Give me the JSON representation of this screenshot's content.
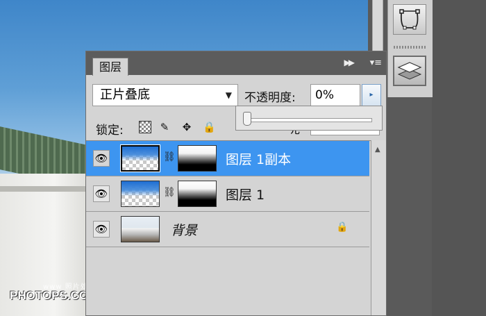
{
  "panel": {
    "tab_label": "图层",
    "collapse_glyph": "▶▶",
    "menu_glyph": "▾≡"
  },
  "blend_mode": {
    "value": "正片叠底",
    "arrow": "▼"
  },
  "opacity": {
    "label": "不透明度:",
    "value": "0%",
    "button_glyph": "▸",
    "slider_level": 0
  },
  "lock": {
    "label": "锁定:",
    "move_glyph": "✥",
    "brush_glyph": "✎",
    "all_glyph": "🔒"
  },
  "fill": {
    "label_visible_fragment": "填充"
  },
  "layers": [
    {
      "name": "图层 1副本",
      "selected": true,
      "visible_glyph": "👁",
      "chain_glyph": "⛓"
    },
    {
      "name": "图层 1",
      "selected": false,
      "visible_glyph": "👁",
      "chain_glyph": "⛓"
    },
    {
      "name": "背景",
      "selected": false,
      "visible_glyph": "👁",
      "locked_glyph": "🔒"
    }
  ],
  "scroll": {
    "up_glyph": "▲"
  },
  "watermark": {
    "top_text": "照片处理网",
    "main_text": "PHOTOPS.COM",
    "prefix": "www"
  },
  "colors": {
    "selection": "#3d95f0",
    "panel_bg": "#d4d4d4",
    "header_bg": "#5c5c5c"
  }
}
